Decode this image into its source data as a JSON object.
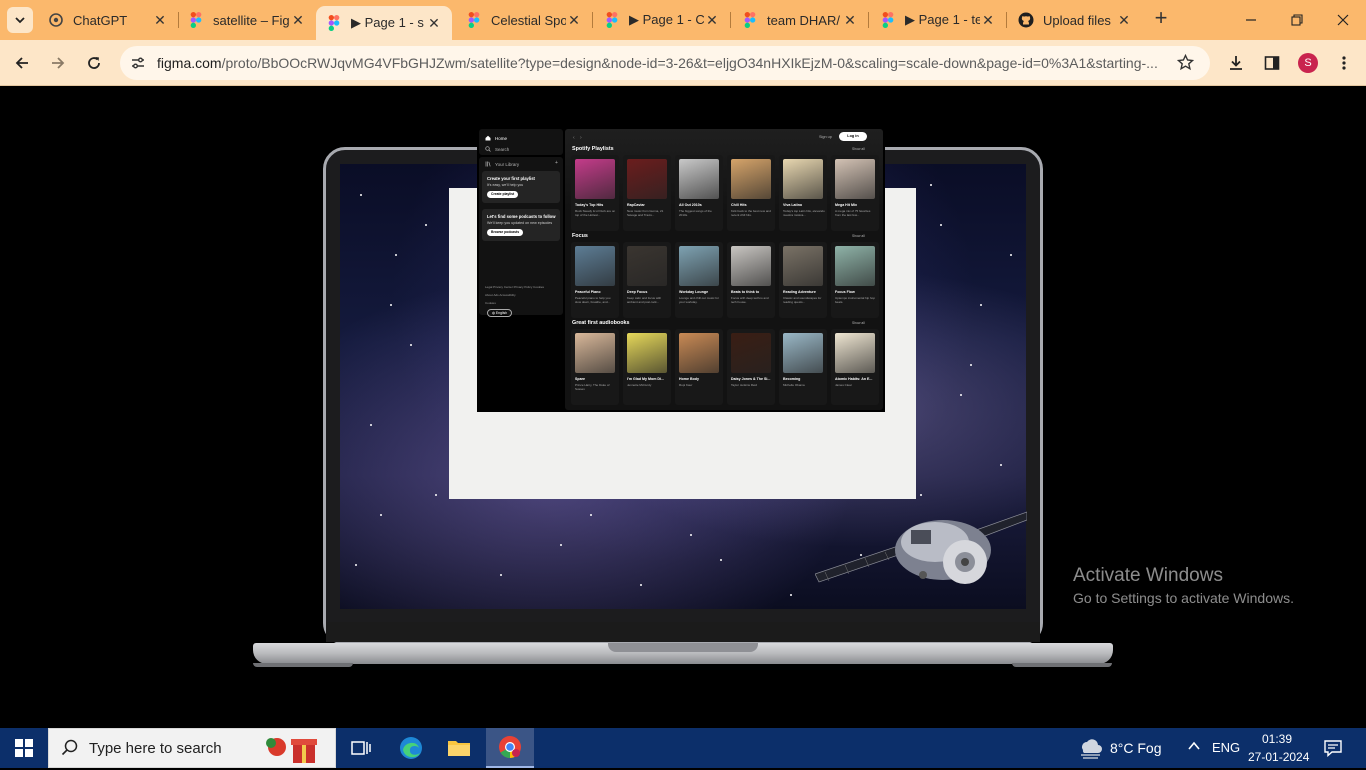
{
  "browser": {
    "tabs": [
      {
        "title": "ChatGPT",
        "icon": "chatgpt-icon",
        "active": false
      },
      {
        "title": "satellite – Fig",
        "icon": "figma-icon",
        "active": false
      },
      {
        "title": "▶ Page 1 - s",
        "icon": "figma-icon",
        "active": true
      },
      {
        "title": "Celestial Spo",
        "icon": "figma-icon",
        "active": false
      },
      {
        "title": "▶ Page 1 - C",
        "icon": "figma-icon",
        "active": false
      },
      {
        "title": "team DHAR/",
        "icon": "figma-icon",
        "active": false
      },
      {
        "title": "▶ Page 1 - te",
        "icon": "figma-icon",
        "active": false
      },
      {
        "title": "Upload files",
        "icon": "github-icon",
        "active": false
      }
    ],
    "url_host": "figma.com",
    "url_path": "/proto/BbOOcRWJqvMG4VFbGHJZwm/satellite?type=design&node-id=3-26&t=eljgO34nHXIkEjzM-0&scaling=scale-down&page-id=0%3A1&starting-...",
    "profile_initial": "S"
  },
  "spotify": {
    "sidebar": {
      "home": "Home",
      "search": "Search",
      "library": "Your Library",
      "card1_title": "Create your first playlist",
      "card1_sub": "It's easy, we'll help you",
      "card1_btn": "Create playlist",
      "card2_title": "Let's find some podcasts to follow",
      "card2_sub": "We'll keep you updated on new episodes",
      "card2_btn": "Browse podcasts",
      "links1": "Legal    Privacy Center    Privacy Policy    Cookies",
      "links2": "About Ads    Accessibility",
      "links3": "Cookies",
      "lang": "English"
    },
    "header": {
      "signup": "Sign up",
      "login": "Log in"
    },
    "sections": [
      {
        "title": "Spotify Playlists",
        "show_all": "Show all",
        "cards": [
          {
            "title": "Today's Top Hits",
            "desc": "Rock Steady & Lil Durk are on top of the Hottest...",
            "color": "#c43c8a"
          },
          {
            "title": "RapCaviar",
            "desc": "New music from Gunna, 21 Savage and Travis...",
            "color": "#6b1d1d"
          },
          {
            "title": "All Out 2010s",
            "desc": "The biggest songs of the 2010s.",
            "color": "#c9c9c9"
          },
          {
            "title": "Chill Hits",
            "desc": "Kick back to the best new and recent chill hits.",
            "color": "#d6a46a"
          },
          {
            "title": "Viva Latino",
            "desc": "Today's top Latin hits, elevando nuestra música...",
            "color": "#e8d7b0"
          },
          {
            "title": "Mega Hit Mix",
            "desc": "A mega mix of 75 favorites from the last few...",
            "color": "#d3c2b4"
          }
        ]
      },
      {
        "title": "Focus",
        "show_all": "Show all",
        "cards": [
          {
            "title": "Peaceful Piano",
            "desc": "Peaceful piano to help you slow down, breathe, and...",
            "color": "#5d7d95"
          },
          {
            "title": "Deep Focus",
            "desc": "Keep calm and focus with ambient and post-rock...",
            "color": "#3a3530"
          },
          {
            "title": "Workday Lounge",
            "desc": "Lounge and chill out music for your workday.",
            "color": "#7ea2b2"
          },
          {
            "title": "Beats to think to",
            "desc": "Focus with deep techno and tech house.",
            "color": "#c9c6c2"
          },
          {
            "title": "Reading Adventure",
            "desc": "Classic and soundscapes for reading quests...",
            "color": "#7a7266"
          },
          {
            "title": "Focus Flow",
            "desc": "Uptempo instrumental hip hop beats.",
            "color": "#8fb3a8"
          }
        ]
      },
      {
        "title": "Great first audiobooks",
        "show_all": "Show all",
        "cards": [
          {
            "title": "Spare",
            "desc": "Prince Harry, The Duke of Sussex",
            "color": "#d9b89a"
          },
          {
            "title": "I'm Glad My Mom Di...",
            "desc": "Jennette McCurdy",
            "color": "#e6d85a"
          },
          {
            "title": "Home Body",
            "desc": "Rupi Kaur",
            "color": "#c98a55"
          },
          {
            "title": "Daisy Jones & The Si...",
            "desc": "Taylor Jenkins Reid",
            "color": "#3a1e14"
          },
          {
            "title": "Becoming",
            "desc": "Michelle Obama",
            "color": "#9ab8c7"
          },
          {
            "title": "Atomic Habits: An E...",
            "desc": "James Clear",
            "color": "#efe6d2"
          }
        ]
      }
    ]
  },
  "watermark": {
    "line1": "Activate Windows",
    "line2": "Go to Settings to activate Windows."
  },
  "taskbar": {
    "search_placeholder": "Type here to search",
    "weather": "8°C  Fog",
    "lang": "ENG",
    "time": "01:39",
    "date": "27-01-2024"
  }
}
